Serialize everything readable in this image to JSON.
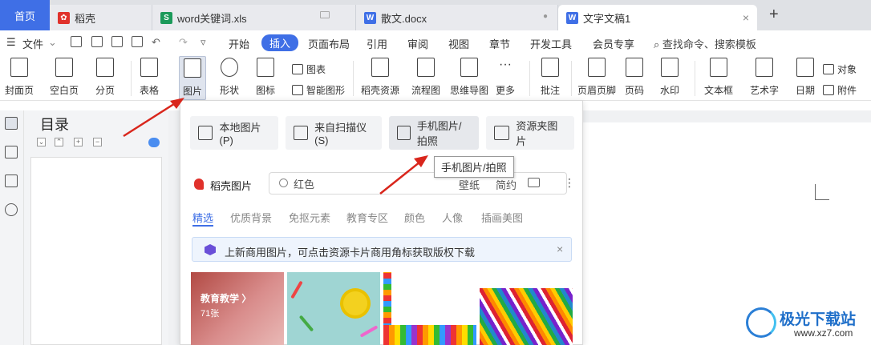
{
  "tabs": {
    "home": "首页",
    "items": [
      {
        "label": "稻壳",
        "icon_color": "#e0312b",
        "icon_glyph": "✿"
      },
      {
        "label": "word关键词.xls",
        "icon_color": "#1c9a5a",
        "icon_glyph": "S"
      },
      {
        "label": "散文.docx",
        "icon_color": "#3f6fe6",
        "icon_glyph": "W"
      },
      {
        "label": "文字文稿1",
        "icon_color": "#3f6fe6",
        "icon_glyph": "W"
      }
    ],
    "add": "+",
    "close": "×"
  },
  "menu": {
    "file": "文件",
    "items": [
      "开始",
      "插入",
      "页面布局",
      "引用",
      "审阅",
      "视图",
      "章节",
      "开发工具",
      "会员专享"
    ],
    "active_index": 1,
    "search": "查找命令、搜索模板"
  },
  "ribbon": {
    "cover": "封面页",
    "blank": "空白页",
    "pagebreak": "分页",
    "table": "表格",
    "picture": "图片",
    "shape": "形状",
    "icon": "图标",
    "chart": "图表",
    "smart": "智能图形",
    "daoke_res": "稻壳资源",
    "flow": "流程图",
    "mindmap": "思维导图",
    "more": "更多",
    "comment": "批注",
    "headerfooter": "页眉页脚",
    "pagenum": "页码",
    "watermark": "水印",
    "textbox": "文本框",
    "arttext": "艺术字",
    "date": "日期",
    "object": "对象",
    "attachment": "附件"
  },
  "toc": {
    "title": "目录"
  },
  "dropdown": {
    "options": [
      "本地图片(P)",
      "来自扫描仪(S)",
      "手机图片/拍照",
      "资源夹图片"
    ],
    "tooltip": "手机图片/拍照",
    "daoke_title": "稻壳图片",
    "search_value": "红色",
    "search_tags": [
      "壁纸",
      "简约"
    ],
    "categories": [
      "精选",
      "优质背景",
      "免抠元素",
      "教育专区",
      "颜色",
      "人像",
      "插画美图"
    ],
    "notice": "上新商用图片，可点击资源卡片商用角标获取版权下载",
    "thumb1_label": "教育教学 〉",
    "thumb1_count": "71张"
  },
  "watermark": {
    "name": "极光下载站",
    "url": "www.xz7.com"
  },
  "colors": {
    "accent": "#3f6fe6",
    "arrow": "#d9261c"
  }
}
